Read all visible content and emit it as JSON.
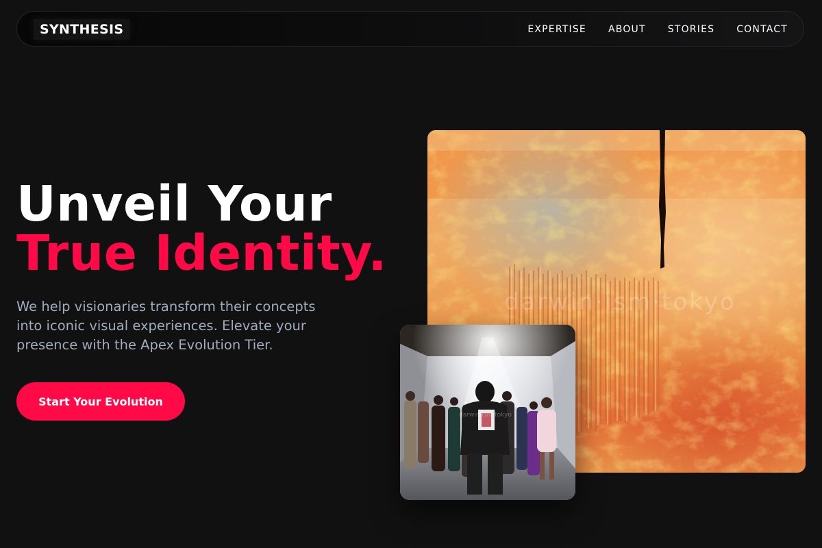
{
  "brand": {
    "name": "SYNTHESIS"
  },
  "nav": {
    "items": [
      {
        "label": "EXPERTISE"
      },
      {
        "label": "ABOUT"
      },
      {
        "label": "STORIES"
      },
      {
        "label": "CONTACT"
      }
    ]
  },
  "hero": {
    "title_line1": "Unveil Your",
    "title_line2": "True Identity.",
    "description": "We help visionaries transform their concepts into iconic visual experiences. Elevate your presence with the Apex Evolution Tier.",
    "cta_label": "Start Your Evolution"
  },
  "images": {
    "main_watermark": "darwin·ism·tokyo",
    "secondary_watermark": "darwin·ism·tokyo"
  },
  "colors": {
    "background": "#111112",
    "accent": "#ff0a47",
    "text_primary": "#ffffff",
    "text_muted": "#a3acbd"
  }
}
